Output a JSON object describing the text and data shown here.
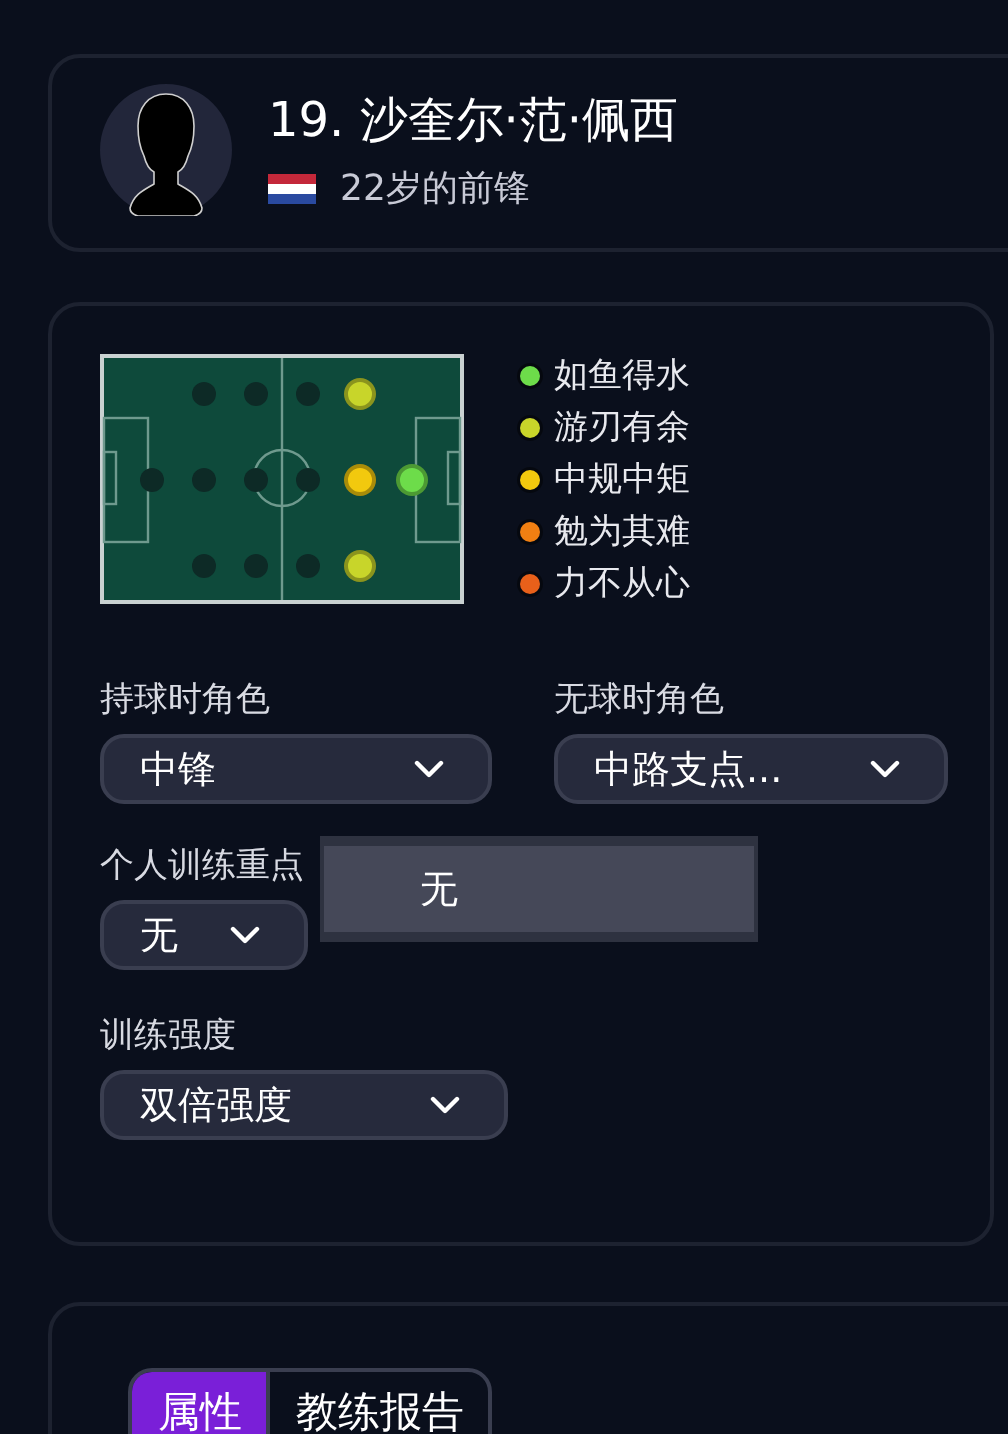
{
  "player": {
    "name": "19. 沙奎尔·范·佩西",
    "description": "22岁的前锋"
  },
  "pitch": {
    "rows": [
      {
        "spots": [
          {
            "color": "#0d2a26"
          },
          {
            "color": "#0d2a26"
          },
          {
            "color": "#0d2a26"
          },
          {
            "color": "#c8d52a"
          }
        ]
      },
      {
        "spots": [
          {
            "color": "#0d2a26"
          },
          {
            "color": "#0d2a26"
          },
          {
            "color": "#0d2a26"
          },
          {
            "color": "#0d2a26"
          },
          {
            "color": "#f2c90e"
          },
          {
            "color": "#6ddc4a"
          }
        ]
      },
      {
        "spots": [
          {
            "color": "#0d2a26"
          },
          {
            "color": "#0d2a26"
          },
          {
            "color": "#0d2a26"
          },
          {
            "color": "#c8d52a"
          }
        ]
      }
    ]
  },
  "legend": [
    {
      "label": "如鱼得水",
      "color": "#6ddc4a"
    },
    {
      "label": "游刃有余",
      "color": "#c8d52a"
    },
    {
      "label": "中规中矩",
      "color": "#f2c90e"
    },
    {
      "label": "勉为其难",
      "color": "#f07f12"
    },
    {
      "label": "力不从心",
      "color": "#e8601a"
    }
  ],
  "in_possession_role": {
    "label": "持球时角色",
    "value": "中锋"
  },
  "out_of_possession_role": {
    "label": "无球时角色",
    "value": "中路支点..."
  },
  "training_focus": {
    "label": "个人训练重点",
    "value": "无",
    "expanded": true,
    "options": [
      {
        "label": "无",
        "selected": true
      }
    ]
  },
  "training_intensity": {
    "label": "训练强度",
    "value": "双倍强度"
  },
  "tabs": [
    {
      "label": "属性",
      "selected": true
    },
    {
      "label": "教练报告",
      "selected": false
    }
  ]
}
